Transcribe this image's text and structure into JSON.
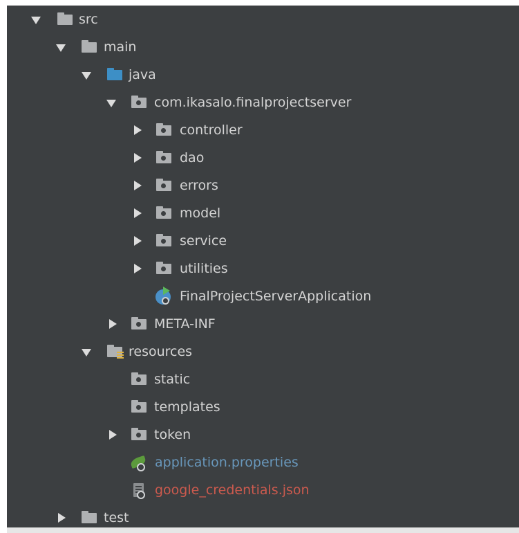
{
  "tree": {
    "colors": {
      "background": "#3c3f41",
      "text": "#d4d4d4",
      "source_folder": "#3d8fc6",
      "properties_text": "#6897bb",
      "json_text": "#cc5a4e"
    },
    "nodes": [
      {
        "label": "src",
        "expanded": true,
        "icon": "folder-icon"
      },
      {
        "label": "main",
        "expanded": true,
        "icon": "folder-icon"
      },
      {
        "label": "java",
        "expanded": true,
        "icon": "source-folder-icon"
      },
      {
        "label": "com.ikasalo.finalprojectserver",
        "expanded": true,
        "icon": "package-icon"
      },
      {
        "label": "controller",
        "expanded": false,
        "icon": "package-icon"
      },
      {
        "label": "dao",
        "expanded": false,
        "icon": "package-icon"
      },
      {
        "label": "errors",
        "expanded": false,
        "icon": "package-icon"
      },
      {
        "label": "model",
        "expanded": false,
        "icon": "package-icon"
      },
      {
        "label": "service",
        "expanded": false,
        "icon": "package-icon"
      },
      {
        "label": "utilities",
        "expanded": false,
        "icon": "package-icon"
      },
      {
        "label": "FinalProjectServerApplication",
        "icon": "spring-boot-app-icon"
      },
      {
        "label": "META-INF",
        "expanded": false,
        "icon": "package-icon"
      },
      {
        "label": "resources",
        "expanded": true,
        "icon": "resources-folder-icon"
      },
      {
        "label": "static",
        "icon": "package-icon"
      },
      {
        "label": "templates",
        "icon": "package-icon"
      },
      {
        "label": "token",
        "expanded": false,
        "icon": "package-icon"
      },
      {
        "label": "application.properties",
        "icon": "spring-properties-icon"
      },
      {
        "label": "google_credentials.json",
        "icon": "json-file-icon"
      },
      {
        "label": "test",
        "expanded": false,
        "icon": "folder-icon"
      }
    ]
  }
}
